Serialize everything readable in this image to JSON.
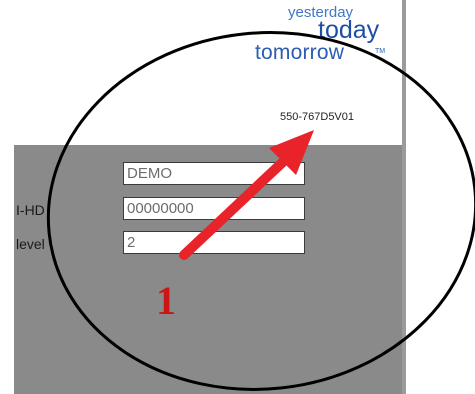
{
  "logo": {
    "line1": "yesterday",
    "line2": "today",
    "line3": "tomorrow",
    "trademark": "TM",
    "colors": {
      "light": "#3f78c8",
      "dark": "#1d4fa6"
    }
  },
  "version_code": "550-767D5V01",
  "form": {
    "fields": [
      {
        "label": "",
        "value": "DEMO"
      },
      {
        "label": "HD",
        "value": "00000000"
      },
      {
        "label": "level",
        "value": "2"
      }
    ]
  },
  "annotation": {
    "marker": "1",
    "arrow_color": "#e8232a",
    "circle_color": "#000000"
  }
}
